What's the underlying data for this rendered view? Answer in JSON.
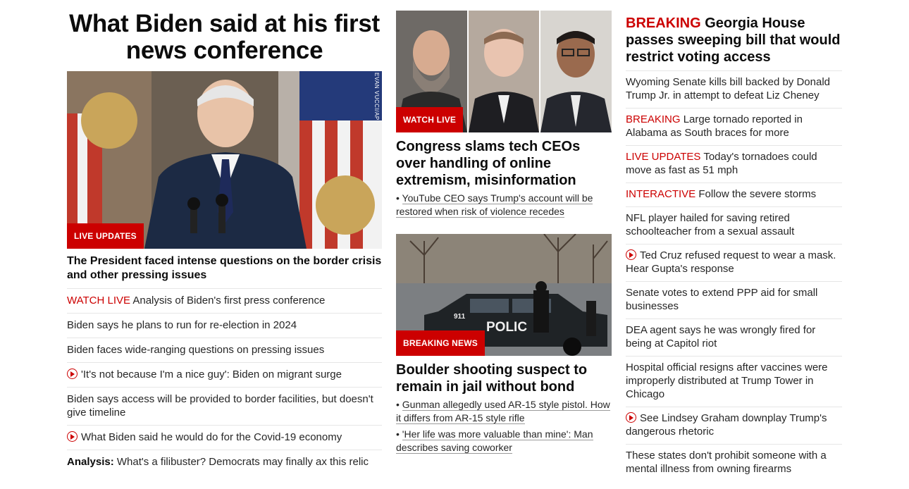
{
  "left": {
    "headline": "What Biden said at his first news conference",
    "image_badge": "LIVE UPDATES",
    "image_credit": "EVAN VUCCI/AP",
    "lead_title": "The President faced intense questions on the border crisis and other pressing issues",
    "items": [
      {
        "prefix": "WATCH LIVE",
        "prefix_style": "red",
        "text": " Analysis of Biden's first press conference",
        "video": false
      },
      {
        "prefix": "",
        "text": "Biden says he plans to run for re-election in 2024",
        "video": false
      },
      {
        "prefix": "",
        "text": "Biden faces wide-ranging questions on pressing issues",
        "video": false
      },
      {
        "prefix": "",
        "text": "'It's not because I'm a nice guy': Biden on migrant surge",
        "video": true
      },
      {
        "prefix": "",
        "text": "Biden says access will be provided to border facilities, but doesn't give timeline",
        "video": false
      },
      {
        "prefix": "",
        "text": "What Biden said he would do for the Covid-19 economy",
        "video": true
      },
      {
        "prefix": "Analysis:",
        "prefix_style": "bold",
        "text": " What's a filibuster? Democrats may finally ax this relic",
        "video": false
      }
    ]
  },
  "middle": {
    "card1": {
      "badge": "WATCH LIVE",
      "title": "Congress slams tech CEOs over handling of online extremism, misinformation",
      "links": [
        "YouTube CEO says Trump's account will be restored when risk of violence recedes"
      ]
    },
    "card2": {
      "badge": "BREAKING NEWS",
      "car_text": "POLIC",
      "car_number": "911",
      "title": "Boulder shooting suspect to remain in jail without bond",
      "links": [
        "Gunman allegedly used AR-15 style pistol. How it differs from AR-15 style rifle",
        "'Her life was more valuable than mine': Man describes saving coworker"
      ]
    }
  },
  "right": {
    "head_prefix": "BREAKING",
    "head_text": " Georgia House passes sweeping bill that would restrict voting access",
    "items": [
      {
        "prefix": "",
        "text": "Wyoming Senate kills bill backed by Donald Trump Jr. in attempt to defeat Liz Cheney",
        "video": false
      },
      {
        "prefix": "BREAKING",
        "text": " Large tornado reported in Alabama as South braces for more",
        "video": false
      },
      {
        "prefix": "LIVE UPDATES",
        "text": " Today's tornadoes could move as fast as 51 mph",
        "video": false
      },
      {
        "prefix": "INTERACTIVE",
        "text": " Follow the severe storms",
        "video": false
      },
      {
        "prefix": "",
        "text": "NFL player hailed for saving retired schoolteacher from a sexual assault",
        "video": false
      },
      {
        "prefix": "",
        "text": "Ted Cruz refused request to wear a mask. Hear Gupta's response",
        "video": true
      },
      {
        "prefix": "",
        "text": "Senate votes to extend PPP aid for small businesses",
        "video": false
      },
      {
        "prefix": "",
        "text": "DEA agent says he was wrongly fired for being at Capitol riot",
        "video": false
      },
      {
        "prefix": "",
        "text": "Hospital official resigns after vaccines were improperly distributed at Trump Tower in Chicago",
        "video": false
      },
      {
        "prefix": "",
        "text": "See Lindsey Graham downplay Trump's dangerous rhetoric",
        "video": true
      },
      {
        "prefix": "",
        "text": "These states don't prohibit someone with a mental illness from owning firearms",
        "video": false
      }
    ]
  }
}
